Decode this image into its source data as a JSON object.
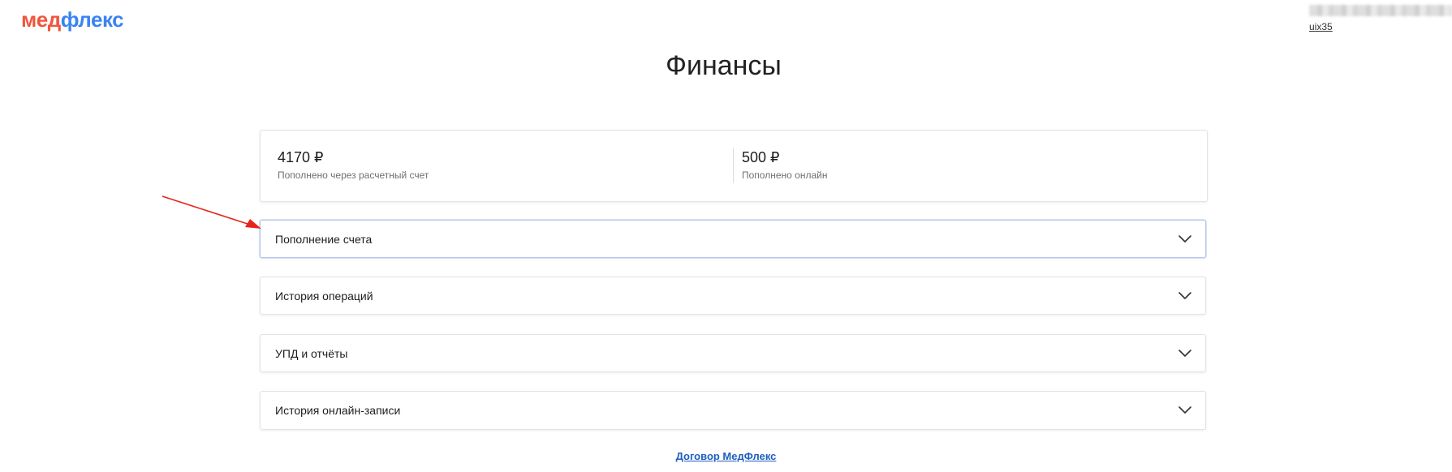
{
  "header": {
    "logo_part_a": "мед",
    "logo_part_b": "флекс",
    "user_name": "uix35"
  },
  "page": {
    "title": "Финансы"
  },
  "summary": {
    "items": [
      {
        "amount": "4170 ₽",
        "label": "Пополнено через расчетный счет"
      },
      {
        "amount": "500 ₽",
        "label": "Пополнено онлайн"
      }
    ]
  },
  "accordions": [
    {
      "label": "Пополнение счета",
      "icon": "chevron-down-icon"
    },
    {
      "label": "История операций",
      "icon": "chevron-down-icon"
    },
    {
      "label": "УПД и отчёты",
      "icon": "chevron-down-icon"
    },
    {
      "label": "История онлайн-записи",
      "icon": "chevron-down-icon"
    }
  ],
  "footer": {
    "contract_link": "Договор МедФлекс"
  },
  "colors": {
    "logo_red": "#f0553c",
    "logo_blue": "#3a84f1",
    "link_blue": "#1f5fbf",
    "annotation_arrow": "#e8231a"
  }
}
